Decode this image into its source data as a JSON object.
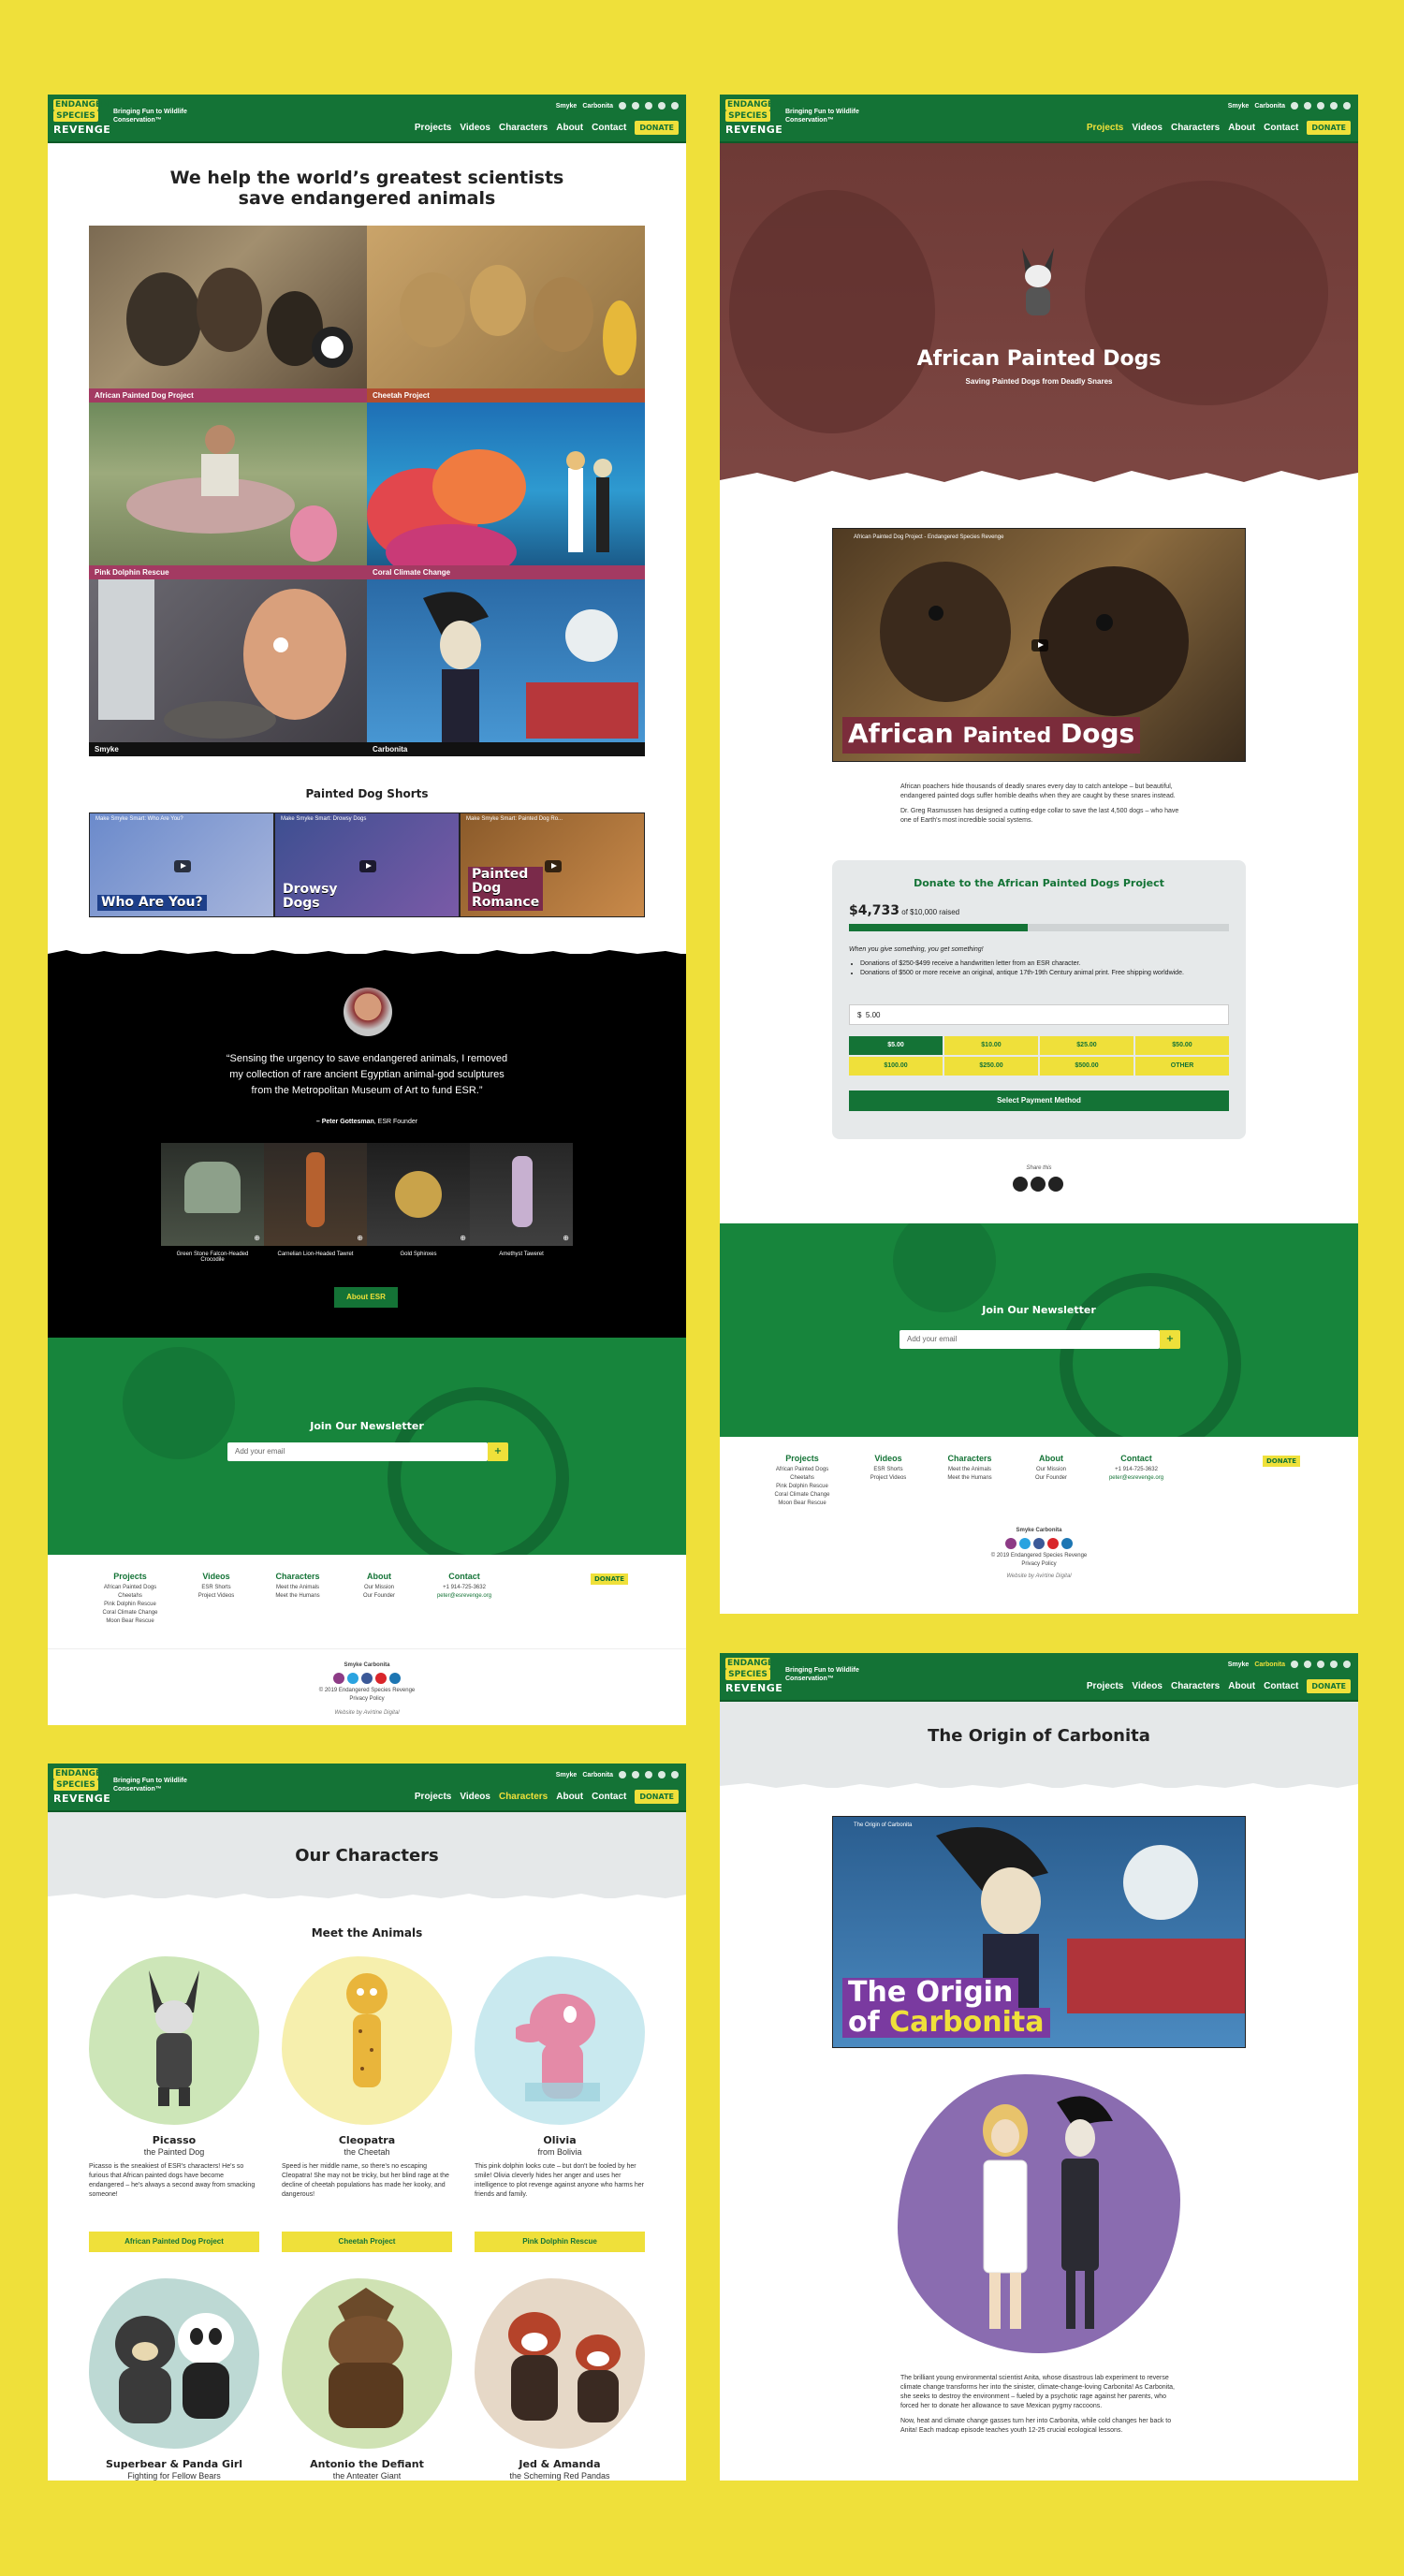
{
  "header": {
    "logo_line1": "ENDANGERED",
    "logo_line2": "SPECIES",
    "logo_line3": "REVENGE",
    "tagline": "Bringing Fun to Wildlife Conservation™",
    "top_links": [
      "Smyke",
      "Carbonita"
    ],
    "nav": [
      "Projects",
      "Videos",
      "Characters",
      "About",
      "Contact"
    ],
    "donate": "DONATE"
  },
  "home": {
    "title_line1": "We help the world’s greatest scientists",
    "title_line2": "save endangered animals",
    "tiles": [
      {
        "label": "African Painted Dog Project",
        "bar": "#a33a62"
      },
      {
        "label": "Cheetah Project",
        "bar": "#b04d30"
      },
      {
        "label": "Pink Dolphin Rescue",
        "bar": "#a33a62"
      },
      {
        "label": "Coral Climate Change",
        "bar": "#a33a62"
      },
      {
        "label": "Smyke",
        "bar": "#111111"
      },
      {
        "label": "Carbonita",
        "bar": "#111111"
      }
    ],
    "shorts_title": "Painted Dog Shorts",
    "shorts": [
      {
        "title": "Make Smyke Smart: Who Are You?",
        "big": "Who Are You?"
      },
      {
        "title": "Make Smyke Smart: Drowsy Dogs",
        "big": "Drowsy Dogs"
      },
      {
        "title": "Make Smyke Smart: Painted Dog Ro...",
        "big": "Painted Dog Romance"
      }
    ],
    "quote": "“Sensing the urgency to save endangered animals, I removed my collection of rare ancient Egyptian animal-god sculptures from the Metropolitan Museum of Art to fund ESR.”",
    "quote_author": "– Peter Gottesman",
    "quote_role": ", ESR Founder",
    "sculptures": [
      "Green Stone Falcon-Headed Crocodile",
      "Carnelian Lion-Headed Tawret",
      "Gold Sphinxes",
      "Amethyst Taweret"
    ],
    "about_btn": "About ESR",
    "newsletter_title": "Join Our Newsletter",
    "email_placeholder": "Add your email",
    "submit": "+"
  },
  "footer": {
    "cols": [
      {
        "h": "Projects",
        "items": [
          "African Painted Dogs",
          "Cheetahs",
          "Pink Dolphin Rescue",
          "Coral Climate Change",
          "Moon Bear Rescue"
        ]
      },
      {
        "h": "Videos",
        "items": [
          "ESR Shorts",
          "Project Videos"
        ]
      },
      {
        "h": "Characters",
        "items": [
          "Meet the Animals",
          "Meet the Humans"
        ]
      },
      {
        "h": "About",
        "items": [
          "Our Mission",
          "Our Founder"
        ]
      },
      {
        "h": "Contact",
        "items": [
          "+1 914-725-3632",
          "peter@esrevenge.org"
        ]
      }
    ],
    "donate": "DONATE",
    "links": "Smyke   Carbonita",
    "copyright": "© 2019 Endangered Species Revenge",
    "privacy": "Privacy Policy",
    "credit": "Website by Avirtine Digital"
  },
  "dogs": {
    "title": "African Painted Dogs",
    "subtitle": "Saving Painted Dogs from Deadly Snares",
    "video_title": "African Painted Dog Project - Endangered Species Revenge",
    "video_big1": "African",
    "video_big2": "Painted",
    "video_big3": "Dogs",
    "p1": "African poachers hide thousands of deadly snares every day to catch antelope – but beautiful, endangered painted dogs suffer horrible deaths when they are caught by these snares instead.",
    "p2": "Dr. Greg Rasmussen has designed a cutting-edge collar to save the last 4,500 dogs – who have one of Earth's most incredible social systems.",
    "donate_title": "Donate to the African Painted Dogs Project",
    "raised": "$4,733",
    "raised_of": "of $10,000 raised",
    "progress": 0.47,
    "give_text": "When you give something, you get something!",
    "bullets": [
      "Donations of $250-$499 receive a handwritten letter from an ESR character.",
      "Donations of $500 or more receive an original, antique 17th-19th Century animal print. Free shipping worldwide."
    ],
    "amount_prefix": "$",
    "amount_value": "5.00",
    "amounts": [
      "$5.00",
      "$10.00",
      "$25.00",
      "$50.00",
      "$100.00",
      "$250.00",
      "$500.00",
      "OTHER"
    ],
    "pay_btn": "Select Payment Method",
    "share": "Share this"
  },
  "characters": {
    "title": "Our Characters",
    "meet": "Meet the Animals",
    "cards": [
      {
        "name": "Picasso",
        "sub": "the Painted Dog",
        "desc": "Picasso is the sneakiest of ESR's characters! He's so furious that African painted dogs have become endangered – he's always a second away from smacking someone!",
        "btn": "African Painted Dog Project",
        "blob": "#cde6b8"
      },
      {
        "name": "Cleopatra",
        "sub": "the Cheetah",
        "desc": "Speed is her middle name, so there's no escaping Cleopatra! She may not be tricky, but her blind rage at the decline of cheetah populations has made her kooky, and dangerous!",
        "btn": "Cheetah Project",
        "blob": "#f6efad"
      },
      {
        "name": "Olivia",
        "sub": "from Bolivia",
        "desc": "This pink dolphin looks cute – but don't be fooled by her smile! Olivia cleverly hides her anger and uses her intelligence to plot revenge against anyone who harms her friends and family.",
        "btn": "Pink Dolphin Rescue",
        "blob": "#c9e9ef"
      },
      {
        "name": "Superbear & Panda Girl",
        "sub": "Fighting for Fellow Bears",
        "blob": "#bdd9d4"
      },
      {
        "name": "Antonio the Defiant",
        "sub": "the Anteater Giant",
        "blob": "#cfe2b3"
      },
      {
        "name": "Jed & Amanda",
        "sub": "the Scheming Red Pandas",
        "blob": "#e6d8c7"
      }
    ]
  },
  "carbonita": {
    "title": "The Origin of Carbonita",
    "video_title": "The Origin of Carbonita",
    "video_big1": "The Origin",
    "video_big2": "of",
    "video_big3": "Carbonita",
    "p1": "The brilliant young environmental scientist Anita, whose disastrous lab experiment to reverse climate change transforms her into the sinister, climate-change-loving Carbonita! As Carbonita, she seeks to destroy the environment – fueled by a psychotic rage against her parents, who forced her to donate her allowance to save Mexican pygmy raccoons.",
    "p2": "Now, heat and climate change gasses turn her into Carbonita, while cold changes her back to Anita! Each madcap episode teaches youth 12-25 crucial ecological lessons."
  }
}
